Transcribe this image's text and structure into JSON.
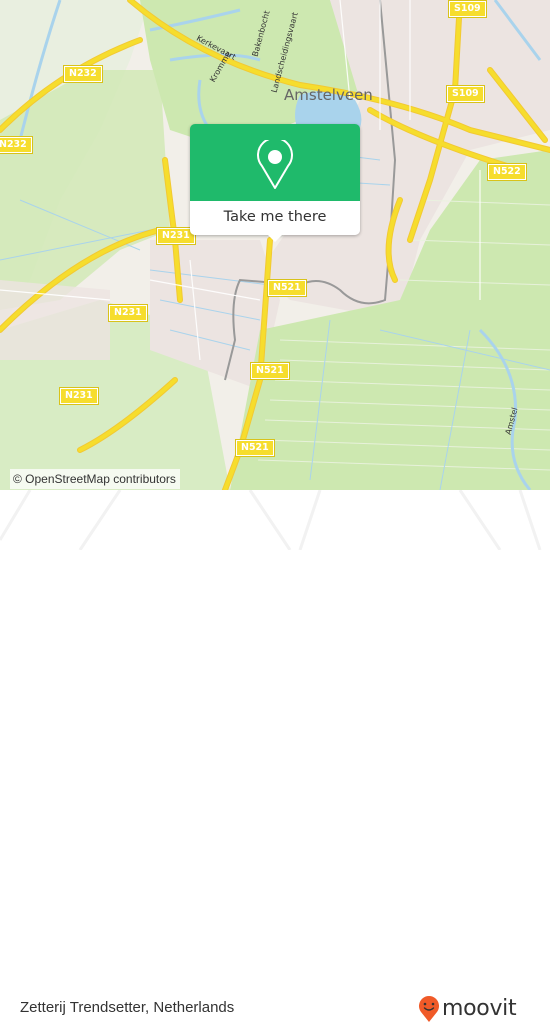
{
  "map": {
    "place_label": "Amstelveen",
    "street_labels": [
      "Kerkevaart",
      "Kromme",
      "Bakenbocht",
      "Landscheidingsvaart",
      "Amstel"
    ],
    "road_shields": [
      {
        "label": "S109"
      },
      {
        "label": "S109"
      },
      {
        "label": "N232"
      },
      {
        "label": "N232"
      },
      {
        "label": "N522"
      },
      {
        "label": "N231"
      },
      {
        "label": "N231"
      },
      {
        "label": "N231"
      },
      {
        "label": "N521"
      },
      {
        "label": "N521"
      },
      {
        "label": "N521"
      }
    ],
    "colors": {
      "land": "#f2efe9",
      "green": "#cde8b0",
      "water": "#a9d3ec",
      "road": "#f6dd2d",
      "urban": "#ece4e1"
    }
  },
  "popup": {
    "icon": "map-pin-icon",
    "button_label": "Take me there",
    "accent_color": "#1fba6b"
  },
  "attribution": "© OpenStreetMap contributors",
  "footer": {
    "location_name": "Zetterij Trendsetter, Netherlands",
    "brand": "moovit",
    "brand_color": "#f05a28"
  }
}
